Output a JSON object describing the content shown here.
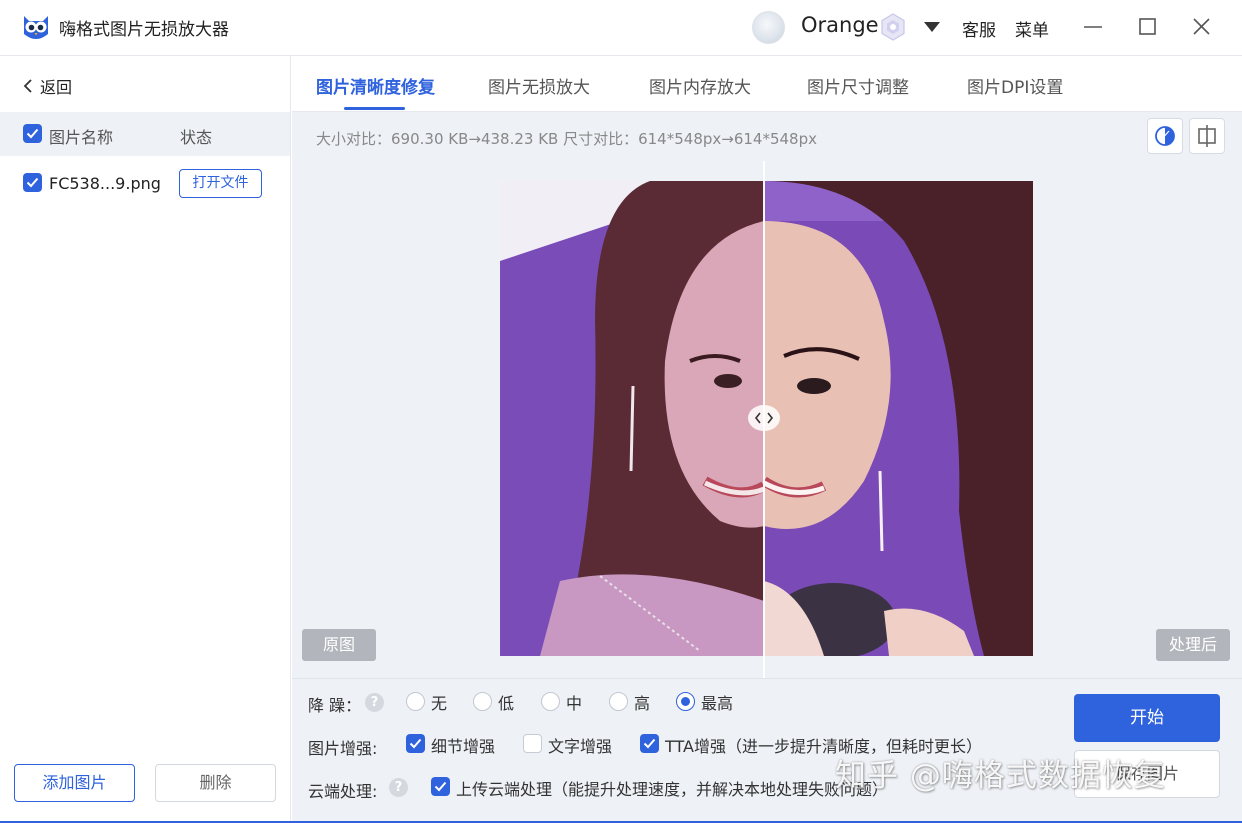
{
  "app": {
    "title": "嗨格式图片无损放大器",
    "username": "Orange",
    "customer_service": "客服",
    "menu": "菜单"
  },
  "sidebar": {
    "back_label": "返回",
    "header_name": "图片名称",
    "header_status": "状态",
    "files": [
      {
        "name": "FC538...9.png",
        "action": "打开文件"
      }
    ],
    "add_button": "添加图片",
    "delete_button": "删除"
  },
  "tabs": [
    {
      "label": "图片清晰度修复",
      "active": true
    },
    {
      "label": "图片无损放大",
      "active": false
    },
    {
      "label": "图片内存放大",
      "active": false
    },
    {
      "label": "图片尺寸调整",
      "active": false
    },
    {
      "label": "图片DPI设置",
      "active": false
    }
  ],
  "compare": {
    "info": "大小对比：690.30 KB→438.23 KB   尺寸对比：614*548px→614*548px",
    "label_original": "原图",
    "label_processed": "处理后"
  },
  "options": {
    "denoise_label": "降 躁：",
    "denoise_levels": [
      "无",
      "低",
      "中",
      "高",
      "最高"
    ],
    "denoise_selected": "最高",
    "enhance_label": "图片增强:",
    "detail_enhance": "细节增强",
    "text_enhance": "文字增强",
    "tta_enhance": "TTA增强（进一步提升清晰度，但耗时更长）",
    "cloud_label": "云端处理:",
    "cloud_upload": "上传云端处理（能提升处理速度，并解决本地处理失败问题）"
  },
  "actions": {
    "start": "开始",
    "save": "保存图片"
  },
  "watermark": "知乎 @嗨格式数据恢复",
  "colors": {
    "accent": "#2f62dd",
    "preview_bg": "#7a4ab6"
  }
}
